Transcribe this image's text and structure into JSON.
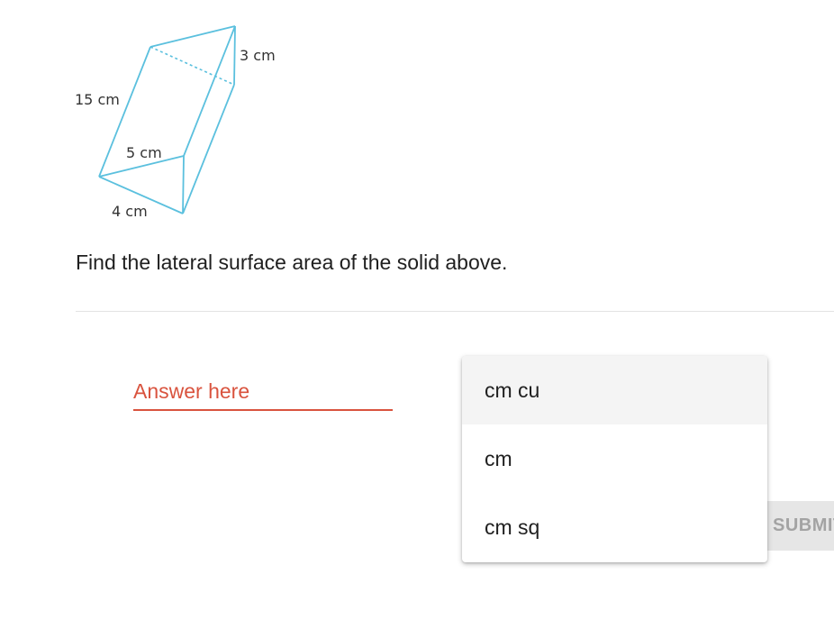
{
  "figure": {
    "labels": {
      "height": "15 cm",
      "right_edge": "3 cm",
      "hypotenuse": "5 cm",
      "base": "4 cm"
    },
    "line_color": "#5bc0de"
  },
  "question": {
    "text": "Find the lateral surface area of the solid above."
  },
  "answer": {
    "placeholder": "Answer here",
    "value": "",
    "accent_color": "#d9533e"
  },
  "unit_dropdown": {
    "options": [
      "cm cu",
      "cm",
      "cm sq"
    ],
    "highlighted_index": 0
  },
  "submit": {
    "label": "SUBMIT"
  }
}
